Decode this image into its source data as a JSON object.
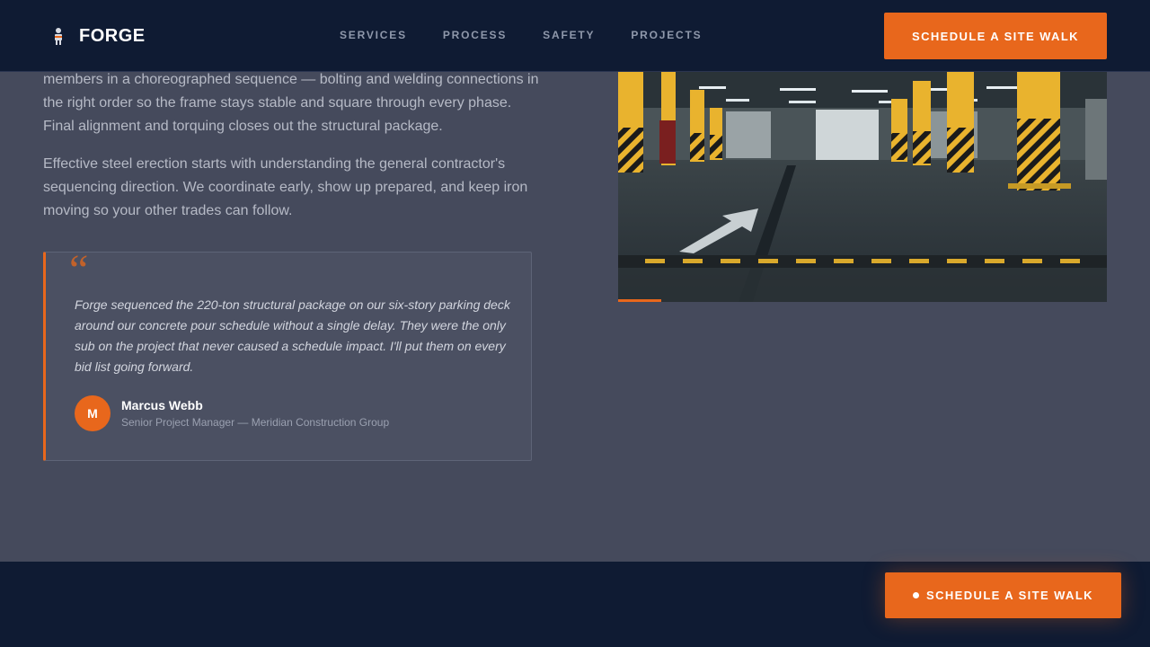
{
  "header": {
    "brand": "FORGE",
    "nav": [
      "SERVICES",
      "PROCESS",
      "SAFETY",
      "PROJECTS"
    ],
    "cta_label": "SCHEDULE A SITE WALK"
  },
  "content": {
    "paragraphs": [
      "members in a choreographed sequence — bolting and welding connections in the right order so the frame stays stable and square through every phase. Final alignment and torquing closes out the structural package.",
      "Effective steel erection starts with understanding the general contractor's sequencing direction. We coordinate early, show up prepared, and keep iron moving so your other trades can follow."
    ]
  },
  "testimonial": {
    "quote_mark": "“",
    "quote": "Forge sequenced the 220-ton structural package on our six-story parking deck around our concrete pour schedule without a single delay. They were the only sub on the project that never caused a schedule impact. I'll put them on every bid list going forward.",
    "avatar_initial": "M",
    "author_name": "Marcus Webb",
    "author_role": "Senior Project Manager — Meridian Construction Group"
  },
  "floating_cta": {
    "label": "SCHEDULE A SITE WALK"
  },
  "colors": {
    "accent": "#e8671c",
    "navy": "#0f1b33",
    "background": "#454a5c"
  },
  "icons": {
    "logo": "worker-icon",
    "image": "parking-garage-photo"
  }
}
